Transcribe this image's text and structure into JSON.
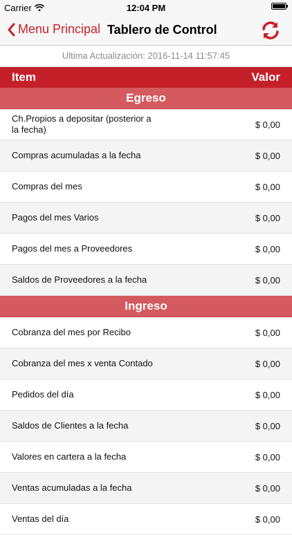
{
  "status_bar": {
    "carrier": "Carrier",
    "time": "12:04 PM",
    "icons": [
      "wifi-icon",
      "battery-icon"
    ]
  },
  "nav": {
    "back_label": "Menu Principal",
    "title": "Tablero de Control",
    "accent_color": "#c8202a",
    "icons": [
      "chevron-left-icon",
      "refresh-icon"
    ]
  },
  "last_update": "Ultima Actualización: 2016-11-14 11:57:45",
  "table": {
    "col_item": "Item",
    "col_value": "Valor",
    "header_color": "#c5202a",
    "section_color": "#d55a5f"
  },
  "sections": [
    {
      "title": "Egreso",
      "rows": [
        {
          "label": "Ch.Propios a depositar (posterior a la fecha)",
          "value": "$ 0,00"
        },
        {
          "label": "Compras acumuladas a la fecha",
          "value": "$ 0,00"
        },
        {
          "label": "Compras del mes",
          "value": "$ 0,00"
        },
        {
          "label": "Pagos del mes Varios",
          "value": "$ 0,00"
        },
        {
          "label": "Pagos del mes a Proveedores",
          "value": "$ 0,00"
        },
        {
          "label": "Saldos de Proveedores a la fecha",
          "value": "$ 0,00"
        }
      ]
    },
    {
      "title": "Ingreso",
      "rows": [
        {
          "label": "Cobranza del mes por Recibo",
          "value": "$ 0,00"
        },
        {
          "label": "Cobranza del mes x venta Contado",
          "value": "$ 0,00"
        },
        {
          "label": "Pedidos del día",
          "value": "$ 0,00"
        },
        {
          "label": "Saldos de Clientes a la fecha",
          "value": "$ 0,00"
        },
        {
          "label": "Valores en cartera a la fecha",
          "value": "$ 0,00"
        },
        {
          "label": "Ventas acumuladas a la fecha",
          "value": "$ 0,00"
        },
        {
          "label": "Ventas del día",
          "value": "$ 0,00"
        }
      ]
    }
  ]
}
